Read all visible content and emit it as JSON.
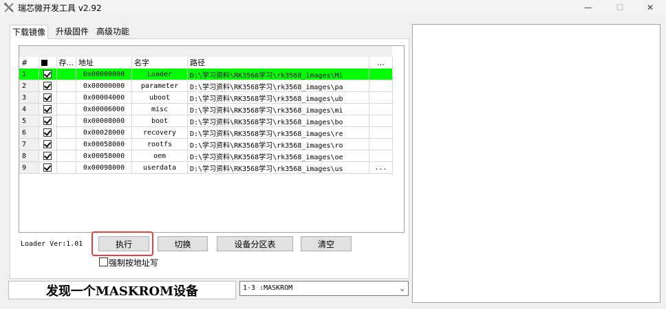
{
  "window": {
    "title": "瑞芯微开发工具 v2.92",
    "controls": {
      "minimize": "—",
      "maximize": "☐",
      "close": "✕"
    }
  },
  "tabs": [
    {
      "label": "下载镜像",
      "active": true
    },
    {
      "label": "升级固件",
      "active": false
    },
    {
      "label": "高级功能",
      "active": false
    }
  ],
  "grid": {
    "columns": [
      "#",
      "■",
      "存...",
      "地址",
      "名字",
      "路径",
      "..."
    ],
    "rows": [
      {
        "num": "1",
        "checked": true,
        "addr": "0x00000000",
        "name": "Loader",
        "path": "D:\\学习资料\\RK3568学习\\rk3568_images\\Mi",
        "extra": "",
        "highlighted": true
      },
      {
        "num": "2",
        "checked": true,
        "addr": "0x00000000",
        "name": "parameter",
        "path": "D:\\学习资料\\RK3568学习\\rk3568_images\\pa",
        "extra": ""
      },
      {
        "num": "3",
        "checked": true,
        "addr": "0x00004000",
        "name": "uboot",
        "path": "D:\\学习资料\\RK3568学习\\rk3568_images\\ub",
        "extra": ""
      },
      {
        "num": "4",
        "checked": true,
        "addr": "0x00006000",
        "name": "misc",
        "path": "D:\\学习资料\\RK3568学习\\rk3568_images\\mi",
        "extra": ""
      },
      {
        "num": "5",
        "checked": true,
        "addr": "0x00008000",
        "name": "boot",
        "path": "D:\\学习资料\\RK3568学习\\rk3568_images\\bo",
        "extra": ""
      },
      {
        "num": "6",
        "checked": true,
        "addr": "0x00028000",
        "name": "recovery",
        "path": "D:\\学习资料\\RK3568学习\\rk3568_images\\re",
        "extra": ""
      },
      {
        "num": "7",
        "checked": true,
        "addr": "0x00058000",
        "name": "rootfs",
        "path": "D:\\学习资料\\RK3568学习\\rk3568_images\\ro",
        "extra": ""
      },
      {
        "num": "8",
        "checked": true,
        "addr": "0x00058000",
        "name": "oem",
        "path": "D:\\学习资料\\RK3568学习\\rk3568_images\\oe",
        "extra": ""
      },
      {
        "num": "9",
        "checked": true,
        "addr": "0x00098000",
        "name": "userdata",
        "path": "D:\\学习资料\\RK3568学习\\rk3568_images\\us",
        "extra": "..."
      }
    ]
  },
  "loader_version": "Loader Ver:1.01",
  "buttons": {
    "execute": "执行",
    "switch": "切换",
    "partition_table": "设备分区表",
    "clear": "清空"
  },
  "force_write": {
    "label": "强制按地址写",
    "checked": false
  },
  "status": {
    "message": "发现一个MASKROM设备"
  },
  "device_select": {
    "value": "1-3 :MASKROM"
  },
  "colors": {
    "highlight_row": "#00ff00",
    "focus_outline": "#e8403c"
  }
}
